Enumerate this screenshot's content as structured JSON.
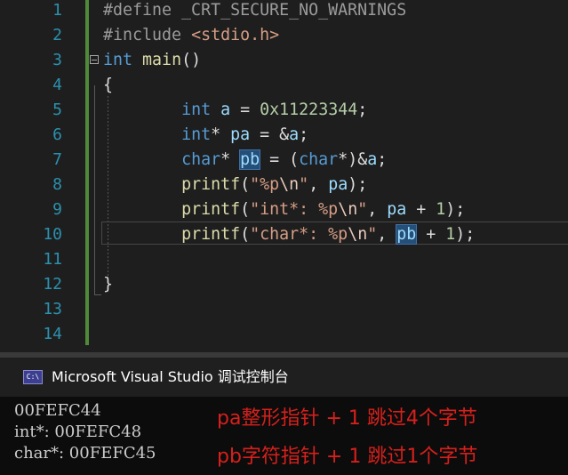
{
  "editor": {
    "lines": [
      {
        "n": "1",
        "tokens": [
          {
            "t": "#define",
            "c": "pre"
          },
          {
            "t": " _CRT_SECURE_NO_WARNINGS",
            "c": "pre"
          }
        ]
      },
      {
        "n": "2",
        "tokens": [
          {
            "t": "#include",
            "c": "pre"
          },
          {
            "t": " ",
            "c": ""
          },
          {
            "t": "<stdio.h>",
            "c": "str"
          }
        ]
      },
      {
        "n": "3",
        "tokens": [
          {
            "t": "int",
            "c": "kw"
          },
          {
            "t": " ",
            "c": ""
          },
          {
            "t": "main",
            "c": "fn"
          },
          {
            "t": "()",
            "c": ""
          }
        ]
      },
      {
        "n": "4",
        "tokens": [
          {
            "t": "{",
            "c": ""
          }
        ]
      },
      {
        "n": "5",
        "tokens": [
          {
            "t": "        ",
            "c": ""
          },
          {
            "t": "int",
            "c": "kw"
          },
          {
            "t": " ",
            "c": ""
          },
          {
            "t": "a",
            "c": "var"
          },
          {
            "t": " = ",
            "c": ""
          },
          {
            "t": "0x11223344",
            "c": "num"
          },
          {
            "t": ";",
            "c": ""
          }
        ]
      },
      {
        "n": "6",
        "tokens": [
          {
            "t": "        ",
            "c": ""
          },
          {
            "t": "int",
            "c": "kw"
          },
          {
            "t": "* ",
            "c": ""
          },
          {
            "t": "pa",
            "c": "var"
          },
          {
            "t": " = &",
            "c": ""
          },
          {
            "t": "a",
            "c": "var"
          },
          {
            "t": ";",
            "c": ""
          }
        ]
      },
      {
        "n": "7",
        "tokens": [
          {
            "t": "        ",
            "c": ""
          },
          {
            "t": "char",
            "c": "kw"
          },
          {
            "t": "* ",
            "c": ""
          },
          {
            "t": "pb",
            "c": "var hl"
          },
          {
            "t": " = (",
            "c": ""
          },
          {
            "t": "char",
            "c": "kw"
          },
          {
            "t": "*)&",
            "c": ""
          },
          {
            "t": "a",
            "c": "var"
          },
          {
            "t": ";",
            "c": ""
          }
        ]
      },
      {
        "n": "8",
        "tokens": [
          {
            "t": "        ",
            "c": ""
          },
          {
            "t": "printf",
            "c": "fn"
          },
          {
            "t": "(",
            "c": ""
          },
          {
            "t": "\"%p",
            "c": "str"
          },
          {
            "t": "\\n",
            "c": "esc"
          },
          {
            "t": "\"",
            "c": "str"
          },
          {
            "t": ", ",
            "c": ""
          },
          {
            "t": "pa",
            "c": "var"
          },
          {
            "t": ");",
            "c": ""
          }
        ]
      },
      {
        "n": "9",
        "tokens": [
          {
            "t": "        ",
            "c": ""
          },
          {
            "t": "printf",
            "c": "fn"
          },
          {
            "t": "(",
            "c": ""
          },
          {
            "t": "\"int*: %p",
            "c": "str"
          },
          {
            "t": "\\n",
            "c": "esc"
          },
          {
            "t": "\"",
            "c": "str"
          },
          {
            "t": ", ",
            "c": ""
          },
          {
            "t": "pa",
            "c": "var"
          },
          {
            "t": " + ",
            "c": ""
          },
          {
            "t": "1",
            "c": "num"
          },
          {
            "t": ");",
            "c": ""
          }
        ]
      },
      {
        "n": "10",
        "tokens": [
          {
            "t": "        ",
            "c": ""
          },
          {
            "t": "printf",
            "c": "fn"
          },
          {
            "t": "(",
            "c": ""
          },
          {
            "t": "\"char*: %p",
            "c": "str"
          },
          {
            "t": "\\n",
            "c": "esc"
          },
          {
            "t": "\"",
            "c": "str"
          },
          {
            "t": ", ",
            "c": ""
          },
          {
            "t": "pb",
            "c": "var hl"
          },
          {
            "t": " + ",
            "c": ""
          },
          {
            "t": "1",
            "c": "num"
          },
          {
            "t": ");",
            "c": ""
          }
        ]
      },
      {
        "n": "11",
        "tokens": []
      },
      {
        "n": "12",
        "tokens": [
          {
            "t": "}",
            "c": ""
          }
        ]
      },
      {
        "n": "13",
        "tokens": []
      },
      {
        "n": "14",
        "tokens": []
      }
    ]
  },
  "console": {
    "icon_text": "C:\\",
    "title": "Microsoft Visual Studio 调试控制台",
    "output": [
      "00FEFC44",
      "int*: 00FEFC48",
      "char*: 00FEFC45"
    ],
    "notes": [
      "pa整形指针 + 1 跳过4个字节",
      "pb字符指针 + 1 跳过1个字节"
    ]
  },
  "colors": {
    "editor_bg": "#1e1e1e",
    "line_number": "#2b91af",
    "keyword": "#569cd6",
    "string": "#d69d85",
    "annotation": "#d6201c"
  }
}
